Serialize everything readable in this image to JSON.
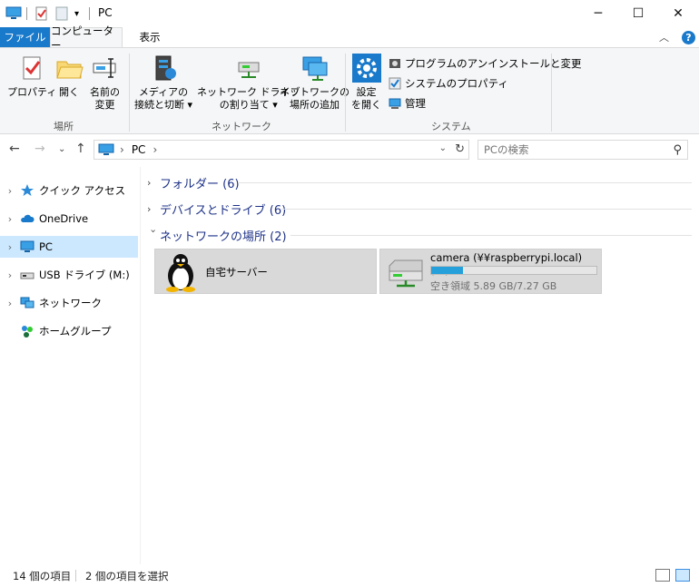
{
  "window": {
    "title": "PC",
    "minimize": "─",
    "maximize": "☐",
    "close": "✕"
  },
  "ribbon_tabs": [
    {
      "label": "ファイル"
    },
    {
      "label": "コンピューター"
    },
    {
      "label": "表示"
    }
  ],
  "ribbon": {
    "groups": {
      "location": "場所",
      "network": "ネットワーク",
      "system": "システム"
    },
    "buttons": {
      "properties": "プロパティ",
      "open": "開く",
      "rename_1": "名前の",
      "rename_2": "変更",
      "media_1": "メディアの",
      "media_2": "接続と切断",
      "map_drive_1": "ネットワーク ドライブ",
      "map_drive_2": "の割り当て",
      "add_network_1": "ネットワークの",
      "add_network_2": "場所の追加",
      "settings_1": "設定",
      "settings_2": "を開く"
    },
    "small_buttons": {
      "uninstall": "プログラムのアンインストールと変更",
      "system_properties": "システムのプロパティ",
      "manage": "管理"
    }
  },
  "address": {
    "crumb": "PC",
    "search_placeholder": "PCの検索"
  },
  "sidebar": {
    "items": [
      {
        "label": "クイック アクセス"
      },
      {
        "label": "OneDrive"
      },
      {
        "label": "PC"
      },
      {
        "label": "USB ドライブ (M:)"
      },
      {
        "label": "ネットワーク"
      },
      {
        "label": "ホームグループ"
      }
    ]
  },
  "main": {
    "groups": [
      {
        "label": "フォルダー (6)"
      },
      {
        "label": "デバイスとドライブ (6)"
      },
      {
        "label": "ネットワークの場所 (2)"
      }
    ],
    "tiles": [
      {
        "label": "自宅サーバー"
      },
      {
        "label": "camera (¥¥raspberrypi.local) (Z:)",
        "free_text": "空き領域 5.89 GB/7.27 GB",
        "used_fraction": 0.19
      }
    ]
  },
  "status": {
    "item_count": "14 個の項目",
    "selected_count": "2 個の項目を選択"
  },
  "colors": {
    "accent": "#1979ca",
    "selection": "#cce8ff",
    "group_heading": "#1e3287",
    "drive_bar": "#26a0da"
  }
}
